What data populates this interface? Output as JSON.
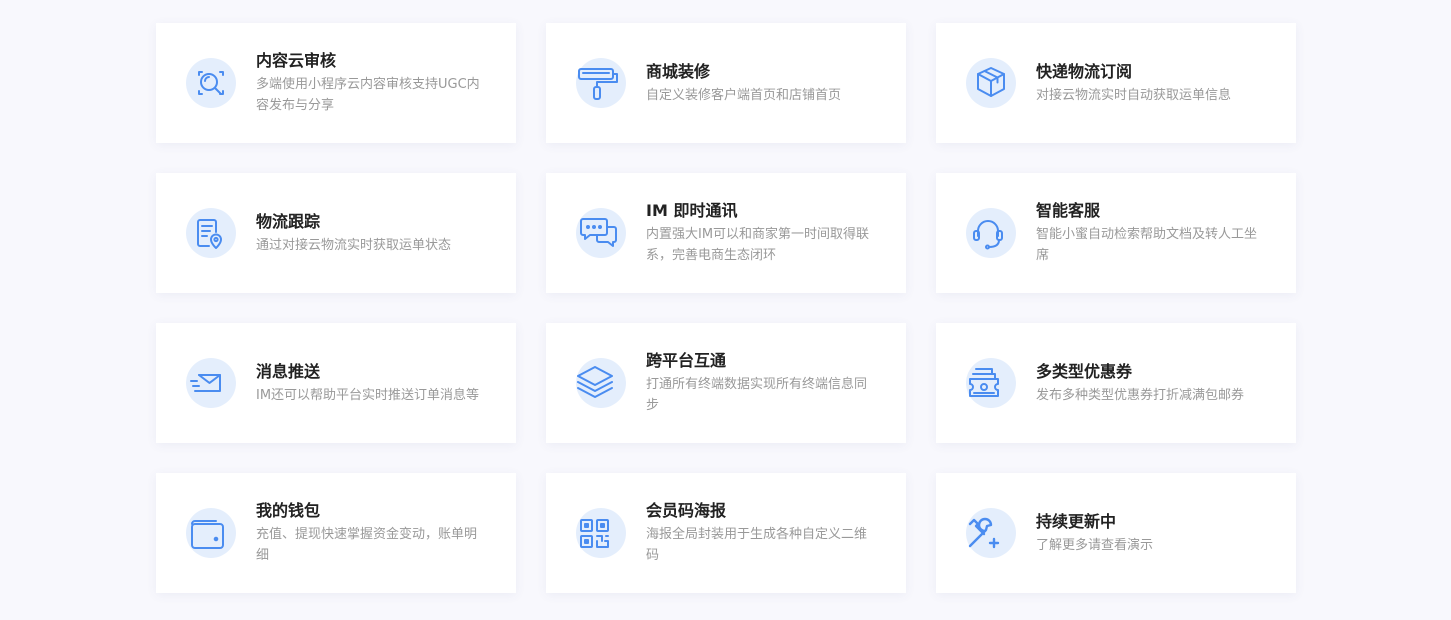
{
  "accent_color": "#4a8cf0",
  "icon_bg_color": "#e4eefc",
  "features": [
    {
      "title": "内容云审核",
      "desc": "多端使用小程序云内容审核支持UGC内容发布与分享",
      "icon": "content-review-icon"
    },
    {
      "title": "商城装修",
      "desc": "自定义装修客户端首页和店铺首页",
      "icon": "paint-roller-icon"
    },
    {
      "title": "快递物流订阅",
      "desc": "对接云物流实时自动获取运单信息",
      "icon": "package-box-icon"
    },
    {
      "title": "物流跟踪",
      "desc": "通过对接云物流实时获取运单状态",
      "icon": "logistics-tracking-icon"
    },
    {
      "title": "IM 即时通讯",
      "desc": "内置强大IM可以和商家第一时间取得联系，完善电商生态闭环",
      "icon": "chat-bubbles-icon"
    },
    {
      "title": "智能客服",
      "desc": "智能小蜜自动检索帮助文档及转人工坐席",
      "icon": "headset-icon"
    },
    {
      "title": "消息推送",
      "desc": "IM还可以帮助平台实时推送订单消息等",
      "icon": "envelope-send-icon"
    },
    {
      "title": "跨平台互通",
      "desc": "打通所有终端数据实现所有终端信息同步",
      "icon": "layers-icon"
    },
    {
      "title": "多类型优惠券",
      "desc": "发布多种类型优惠券打折减满包邮券",
      "icon": "coupon-icon"
    },
    {
      "title": "我的钱包",
      "desc": "充值、提现快速掌握资金变动，账单明细",
      "icon": "wallet-icon"
    },
    {
      "title": "会员码海报",
      "desc": "海报全局封装用于生成各种自定义二维码",
      "icon": "qr-code-icon"
    },
    {
      "title": "持续更新中",
      "desc": "了解更多请查看演示",
      "icon": "wrench-plus-icon"
    }
  ]
}
